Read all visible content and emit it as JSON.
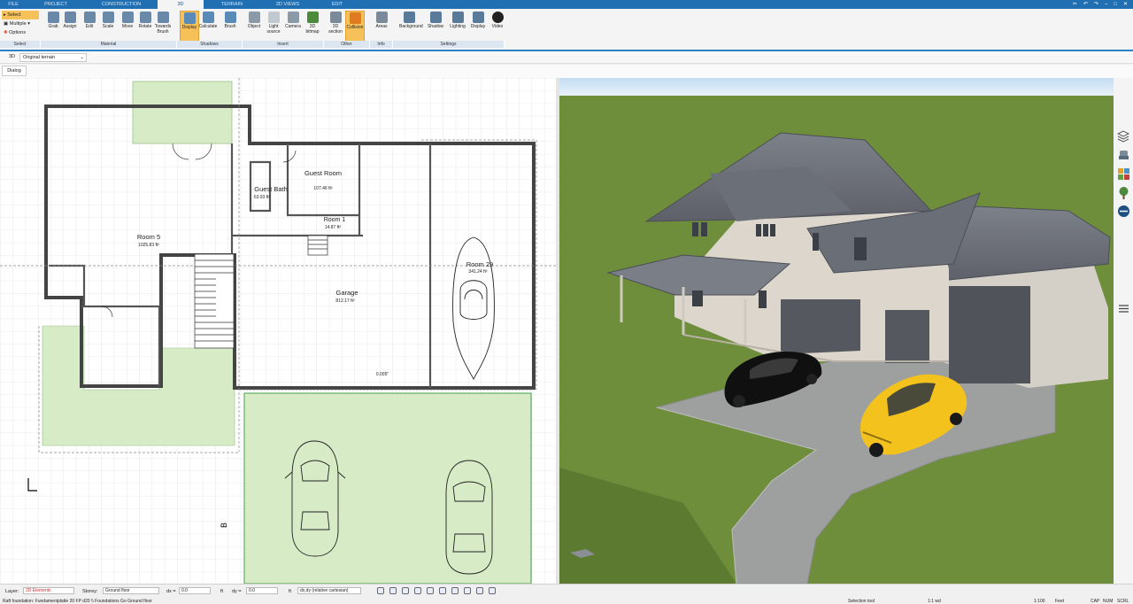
{
  "tabs": [
    {
      "label": "FILE",
      "w": 30
    },
    {
      "label": "PROJECT",
      "w": 66
    },
    {
      "label": "CONSTRUCTION",
      "w": 82
    },
    {
      "label": "3D",
      "w": 52
    },
    {
      "label": "TERRAIN",
      "w": 64
    },
    {
      "label": "2D VIEWS",
      "w": 62
    },
    {
      "label": "EDIT",
      "w": 50
    }
  ],
  "active_tab_index": 3,
  "select_panel": {
    "select": "Select",
    "multiple": "Multiple",
    "options": "Options"
  },
  "ribbon_buttons": [
    "Grab",
    "Assign",
    "Edit",
    "Scale",
    "Move",
    "Rotate",
    "Towards Brush",
    "Display",
    "Calculate",
    "Brush",
    "Object",
    "Light source",
    "Camera",
    "3D bitmap",
    "3D section",
    "Collision",
    "Areas",
    "Background",
    "Shadow",
    "Lighting",
    "Display",
    "Video"
  ],
  "ribbon_groups": [
    "Select",
    "Material",
    "Shadows",
    "Insert",
    "Other",
    "Info",
    "Settings"
  ],
  "subbar": {
    "mode": "3D",
    "terrain": "Original terrain"
  },
  "dialog_label": "Dialog",
  "plan": {
    "rooms": [
      {
        "name": "Room 5",
        "area": "1025.83 ft²"
      },
      {
        "name": "Guest Room",
        "area": "107.46 ft²"
      },
      {
        "name": "Guest Bath",
        "area": "63.93 ft²"
      },
      {
        "name": "Room 1",
        "area": "14.87 ft²"
      },
      {
        "name": "Garage",
        "area": "812.17 ft²"
      },
      {
        "name": "Room 29",
        "area": "341.24 ft²"
      }
    ],
    "elevation_label": "0.005\""
  },
  "status": {
    "layer_label": "Layer:",
    "layer_value": "2D Elements",
    "storey_label": "Storey:",
    "storey_value": "Ground floor",
    "dx_label": "dx =",
    "dx_value": "0.0",
    "dy_label": "dy =",
    "dy_value": "0.0",
    "unit": "ft",
    "coord_mode": "dx,dy (relative cartesian)",
    "path": "Raft foundation: Fundamentplatte 20 FP d20 \\\\ Foundations Go Ground floor",
    "tool": "Selection tool",
    "scale1": "1:1 wd",
    "scale2": "1:100",
    "unit2": "Feet",
    "caps": "CAP",
    "num": "NUM",
    "scrl": "SCRL"
  },
  "colors": {
    "accent": "#1f6fb2",
    "highlight": "#f7c15a",
    "grass": "#6f8e3b",
    "lawn_fill": "#d7ebc6"
  }
}
